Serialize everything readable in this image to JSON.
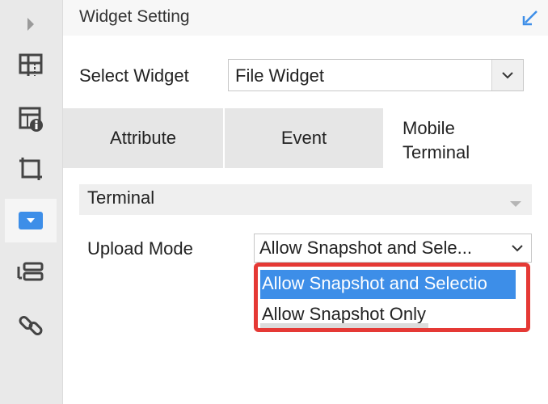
{
  "header": {
    "title": "Widget Setting"
  },
  "select_widget": {
    "label": "Select Widget",
    "value": "File Widget"
  },
  "tabs": [
    {
      "label": "Attribute"
    },
    {
      "label": "Event"
    },
    {
      "label": "Mobile\nTerminal",
      "line1": "Mobile",
      "line2": "Terminal",
      "active": true
    }
  ],
  "section": {
    "title": "Terminal"
  },
  "upload_mode": {
    "label": "Upload Mode",
    "value": "Allow Snapshot and Sele...",
    "options": [
      "Allow Snapshot and Selectio",
      "Allow Snapshot Only"
    ]
  },
  "colors": {
    "accent": "#3d8ee8",
    "highlight": "#e53935",
    "rail_bg": "#e9e9e9",
    "tab_bg": "#e6e6e6"
  },
  "rail_icons": [
    "expand-arrow-icon",
    "table-grid-icon",
    "table-info-icon",
    "frame-icon",
    "dropdown-widget-icon",
    "layout-list-icon",
    "link-icon"
  ]
}
